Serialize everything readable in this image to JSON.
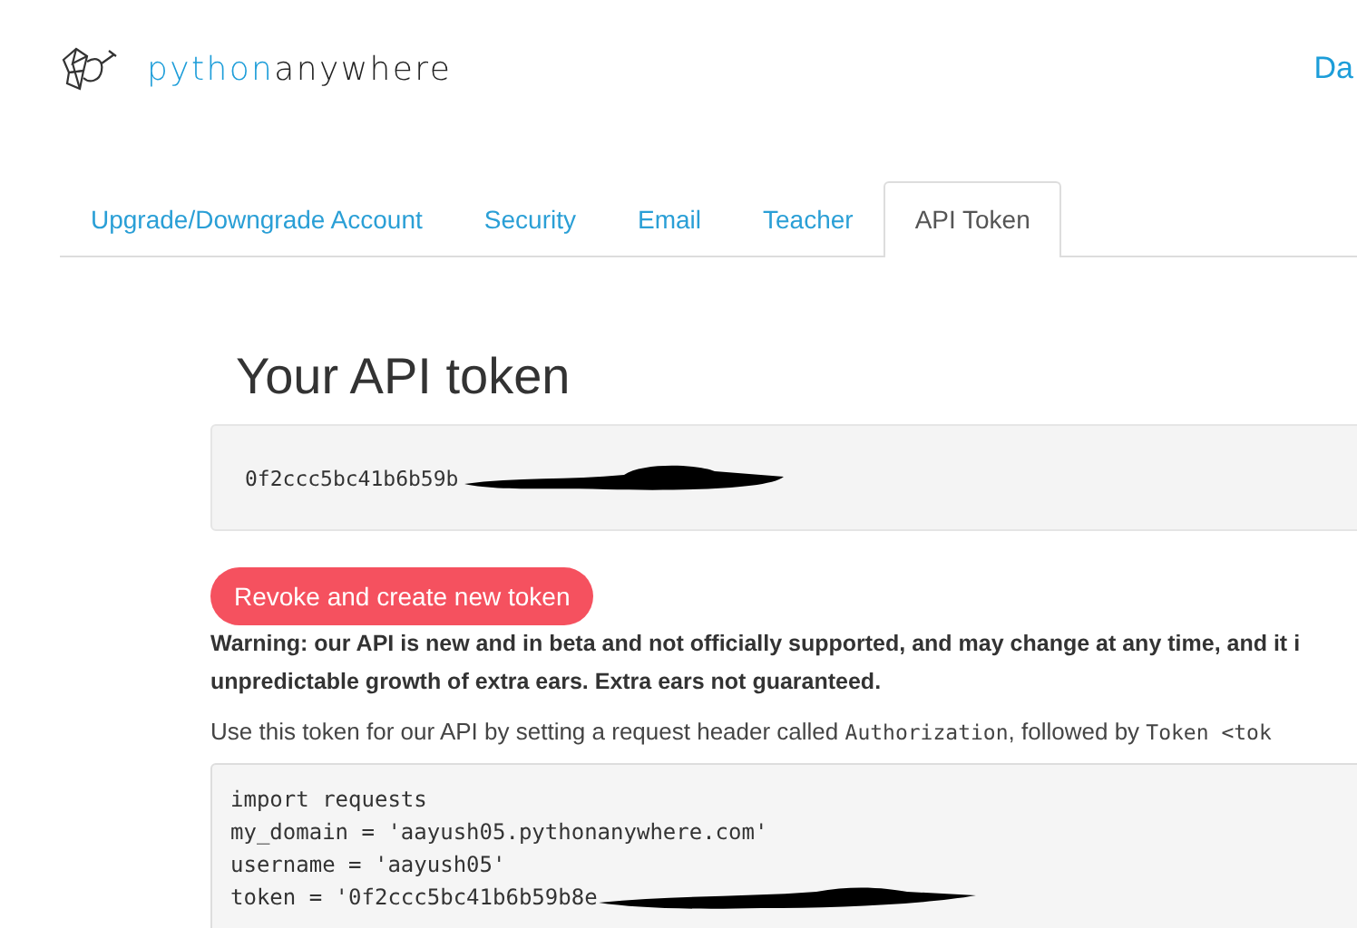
{
  "header": {
    "logo": {
      "part_1": "python",
      "part_2": "anywhere"
    },
    "nav_link": "Da"
  },
  "tabs": [
    {
      "label": "Upgrade/Downgrade Account",
      "selected": false
    },
    {
      "label": "Security",
      "selected": false
    },
    {
      "label": "Email",
      "selected": false
    },
    {
      "label": "Teacher",
      "selected": false
    },
    {
      "label": "API Token",
      "selected": true
    }
  ],
  "heading": "Your API token",
  "token": {
    "value": "0f2ccc5bc41b6b59b",
    "redacted": true
  },
  "revoke_button": "Revoke and create new token",
  "warning": [
    "Warning: our API is new and in beta and not officially supported, and may change at any time, and it i",
    "unpredictable growth of extra ears. Extra ears not guaranteed."
  ],
  "usage": {
    "text": "Use this token for our API by setting a request header called ",
    "code_1": "Authorization",
    "text_2": ", followed by ",
    "code_2": "Token <tok"
  },
  "code_lines": [
    {
      "text": "import requests",
      "redacted": false
    },
    {
      "text": "my_domain = 'aayush05.pythonanywhere.com'",
      "redacted": false
    },
    {
      "text": "username = 'aayush05'",
      "redacted": false
    },
    {
      "text": "token = '0f2ccc5bc41b6b59b8e",
      "redacted": true
    }
  ]
}
